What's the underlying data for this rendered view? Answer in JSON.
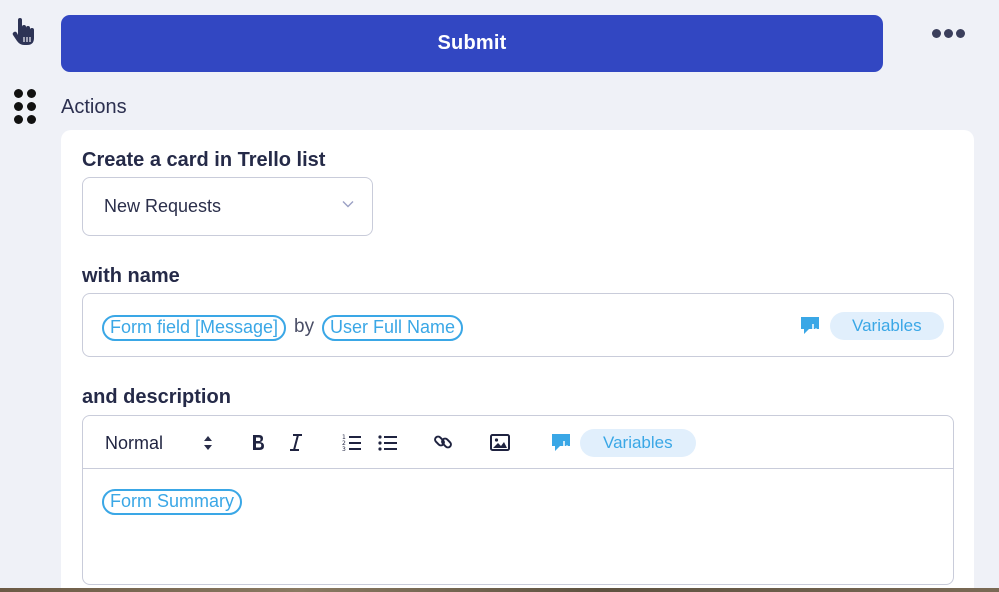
{
  "header": {
    "submit_label": "Submit",
    "actions_label": "Actions"
  },
  "card": {
    "list_label": "Create a card in Trello list",
    "list_select": {
      "value": "New Requests"
    },
    "name_label": "with name",
    "name_field": {
      "chips": [
        "Form field [Message]",
        "User Full Name"
      ],
      "connector": "by",
      "variables_label": "Variables"
    },
    "description_label": "and description",
    "description": {
      "toolbar": {
        "style_value": "Normal",
        "variables_label": "Variables"
      },
      "chips": [
        "Form Summary"
      ]
    }
  },
  "colors": {
    "submit_bg": "#3247c2",
    "chip_blue": "#3aa7e6",
    "pill_bg": "#e1effc",
    "page_bg": "#eff1f7"
  },
  "icons": [
    "hand-pointer-icon",
    "more-dots-icon",
    "drag-handle-icon",
    "chevron-down-icon",
    "variables-icon",
    "bold-icon",
    "italic-icon",
    "ordered-list-icon",
    "bullet-list-icon",
    "link-icon",
    "image-icon"
  ]
}
